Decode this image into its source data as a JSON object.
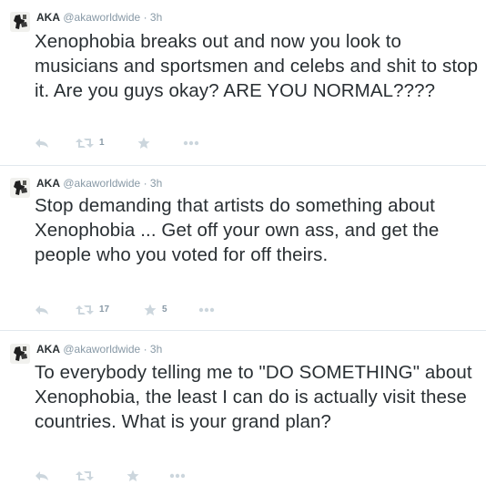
{
  "tweets": [
    {
      "name": "AKA",
      "handle": "@akaworldwide",
      "dot": "·",
      "time": "3h",
      "text": "Xenophobia breaks out and now you look to musicians and sportsmen and celebs and shit to stop it. Are you guys okay? ARE YOU NORMAL????",
      "retweets": "1",
      "favorites": ""
    },
    {
      "name": "AKA",
      "handle": "@akaworldwide",
      "dot": "·",
      "time": "3h",
      "text": "Stop demanding that artists do something about Xenophobia ... Get off your own ass, and get the people who you voted for off theirs.",
      "retweets": "17",
      "favorites": "5"
    },
    {
      "name": "AKA",
      "handle": "@akaworldwide",
      "dot": "·",
      "time": "3h",
      "text": "To everybody telling me to \"DO SOMETHING\" about Xenophobia, the least I can do is actually visit these countries. What is your grand plan?",
      "retweets": "",
      "favorites": ""
    }
  ],
  "icons": {
    "reply": "reply-icon",
    "retweet": "retweet-icon",
    "favorite": "star-icon",
    "more": "more-icon"
  },
  "colors": {
    "text": "#292f33",
    "meta": "#8899a6",
    "action_icon": "#ccd6dd",
    "separator": "#e1e8ed"
  }
}
